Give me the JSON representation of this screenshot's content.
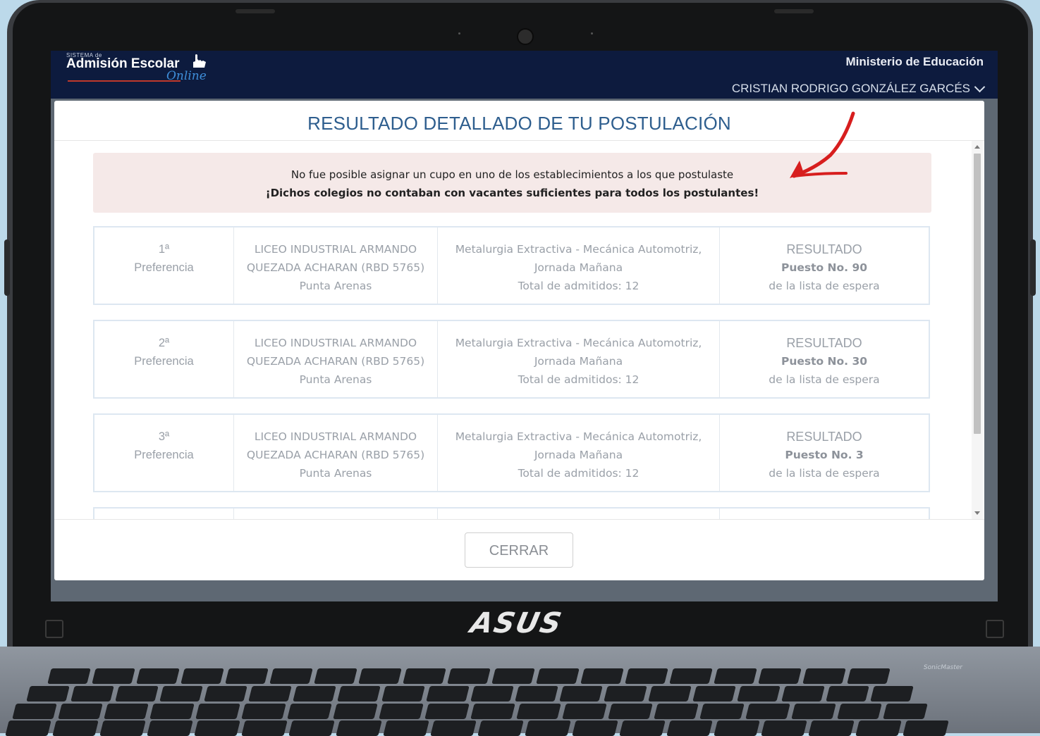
{
  "app": {
    "logo_small": "SISTEMA de",
    "logo_main": "Admisión Escolar",
    "logo_script": "Online"
  },
  "header": {
    "ministry": "Ministerio de Educación",
    "user_name": "CRISTIAN RODRIGO GONZÁLEZ GARCÉS"
  },
  "modal": {
    "title": "RESULTADO DETALLADO DE TU POSTULACIÓN",
    "alert_line1": "No fue posible asignar un cupo en uno de los establecimientos a los que postulaste",
    "alert_line2": "¡Dichos colegios no contaban con vacantes suficientes para todos los postulantes!",
    "close_label": "CERRAR",
    "preferences": [
      {
        "ordinal": "1ª",
        "ordinal_label": "Preferencia",
        "school_line1": "LICEO INDUSTRIAL ARMANDO",
        "school_line2": "QUEZADA ACHARAN (RBD 5765)",
        "school_city": "Punta Arenas",
        "program_line1": "Metalurgia Extractiva - Mecánica Automotriz,",
        "program_line2": "Jornada Mañana",
        "program_total": "Total de admitidos: 12",
        "result_title": "RESULTADO",
        "result_rank": "Puesto No. 90",
        "result_note": "de la lista de espera"
      },
      {
        "ordinal": "2ª",
        "ordinal_label": "Preferencia",
        "school_line1": "LICEO INDUSTRIAL ARMANDO",
        "school_line2": "QUEZADA ACHARAN (RBD 5765)",
        "school_city": "Punta Arenas",
        "program_line1": "Metalurgia Extractiva - Mecánica Automotriz,",
        "program_line2": "Jornada Mañana",
        "program_total": "Total de admitidos: 12",
        "result_title": "RESULTADO",
        "result_rank": "Puesto No. 30",
        "result_note": "de la lista de espera"
      },
      {
        "ordinal": "3ª",
        "ordinal_label": "Preferencia",
        "school_line1": "LICEO INDUSTRIAL ARMANDO",
        "school_line2": "QUEZADA ACHARAN (RBD 5765)",
        "school_city": "Punta Arenas",
        "program_line1": "Metalurgia Extractiva - Mecánica Automotriz,",
        "program_line2": "Jornada Mañana",
        "program_total": "Total de admitidos: 12",
        "result_title": "RESULTADO",
        "result_rank": "Puesto No. 3",
        "result_note": "de la lista de espera"
      }
    ]
  },
  "device": {
    "brand": "ASUS",
    "speaker_label": "SonicMaster"
  },
  "colors": {
    "topbar": "#0d1b3e",
    "title": "#2e5e8e",
    "alert_bg": "#f5e9e8",
    "arrow": "#d71e1e"
  }
}
